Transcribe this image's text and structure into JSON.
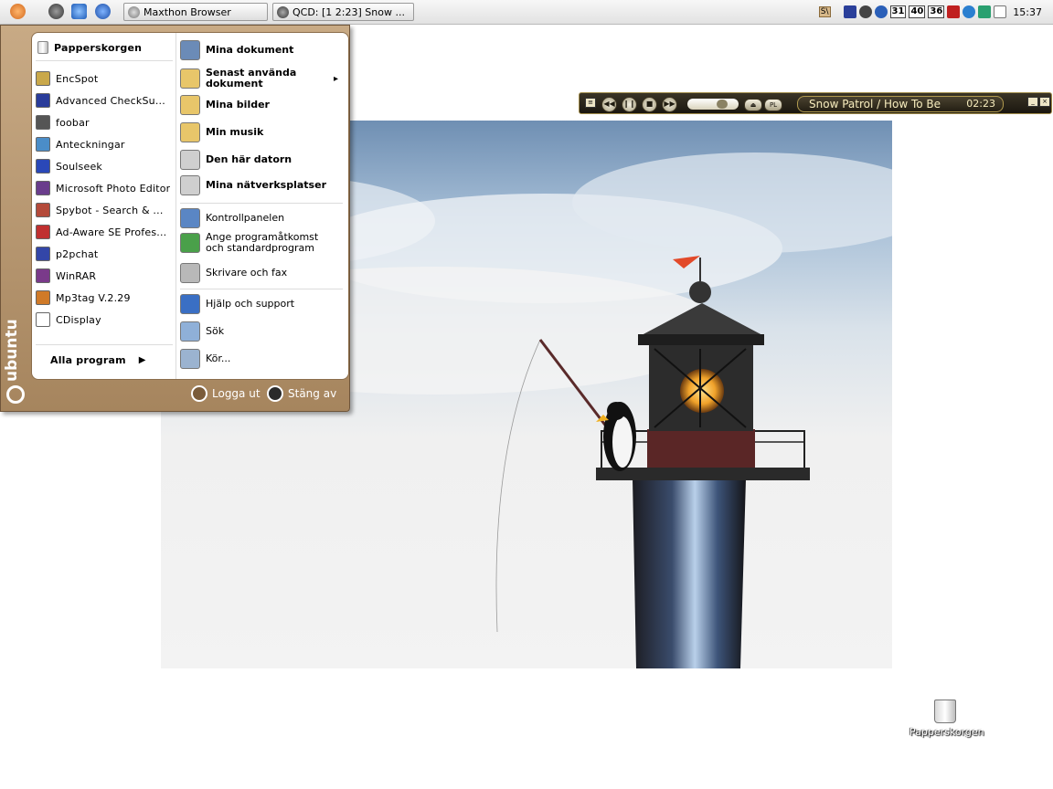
{
  "taskbar": {
    "buttons": [
      {
        "label": "Maxthon Browser"
      },
      {
        "label": "QCD: [1 2:23] Snow ..."
      }
    ],
    "tray": {
      "nums": [
        "31",
        "40",
        "36"
      ],
      "badge": "S\\"
    },
    "clock": "15:37"
  },
  "player": {
    "track": "Snow Patrol / How To Be",
    "time": "02:23",
    "eject_label": "⏏",
    "pl_label": "PL",
    "volume": 0.72
  },
  "start_menu": {
    "brand": "ubuntu",
    "pinned": [
      {
        "label": "Papperskorgen",
        "color": "#e0e0e0"
      }
    ],
    "programs": [
      {
        "label": "EncSpot",
        "color": "#c9a84a"
      },
      {
        "label": "Advanced CheckSu...",
        "color": "#2a3c9a"
      },
      {
        "label": "foobar",
        "color": "#555555"
      },
      {
        "label": "Anteckningar",
        "color": "#4b8dc8"
      },
      {
        "label": "Soulseek",
        "color": "#2a48b8"
      },
      {
        "label": "Microsoft Photo Editor",
        "color": "#6a3d8c"
      },
      {
        "label": "Spybot - Search & ...",
        "color": "#b44a3a"
      },
      {
        "label": "Ad-Aware SE Profes...",
        "color": "#c03030"
      },
      {
        "label": "p2pchat",
        "color": "#3346a8"
      },
      {
        "label": "WinRAR",
        "color": "#7a3a8a"
      },
      {
        "label": "Mp3tag V.2.29",
        "color": "#d07a28"
      },
      {
        "label": "CDisplay",
        "color": "#ffffff"
      }
    ],
    "all_programs": "Alla program",
    "places": [
      {
        "label": "Mina dokument",
        "bold": true,
        "color": "#6b8bb7"
      },
      {
        "label": "Senast använda dokument",
        "bold": true,
        "color": "#e8c66a",
        "arrow": true
      },
      {
        "label": "Mina bilder",
        "bold": true,
        "color": "#e8c66a"
      },
      {
        "label": "Min musik",
        "bold": true,
        "color": "#e8c66a"
      },
      {
        "label": "Den här datorn",
        "bold": true,
        "color": "#cfcfcf"
      },
      {
        "label": "Mina nätverksplatser",
        "bold": true,
        "color": "#cfcfcf"
      },
      {
        "label": "Kontrollpanelen",
        "bold": false,
        "color": "#5a86c4"
      },
      {
        "label": "Ange programåtkomst och standardprogram",
        "bold": false,
        "color": "#4aa04a"
      },
      {
        "label": "Skrivare och fax",
        "bold": false,
        "color": "#b8b8b8"
      },
      {
        "label": "Hjälp och support",
        "bold": false,
        "color": "#3a6fc4"
      },
      {
        "label": "Sök",
        "bold": false,
        "color": "#8fb0d8"
      },
      {
        "label": "Kör...",
        "bold": false,
        "color": "#9bb3d0"
      }
    ],
    "logout": "Logga ut",
    "shutdown": "Stäng av"
  },
  "desktop": {
    "recycle_label": "Papperskorgen"
  }
}
